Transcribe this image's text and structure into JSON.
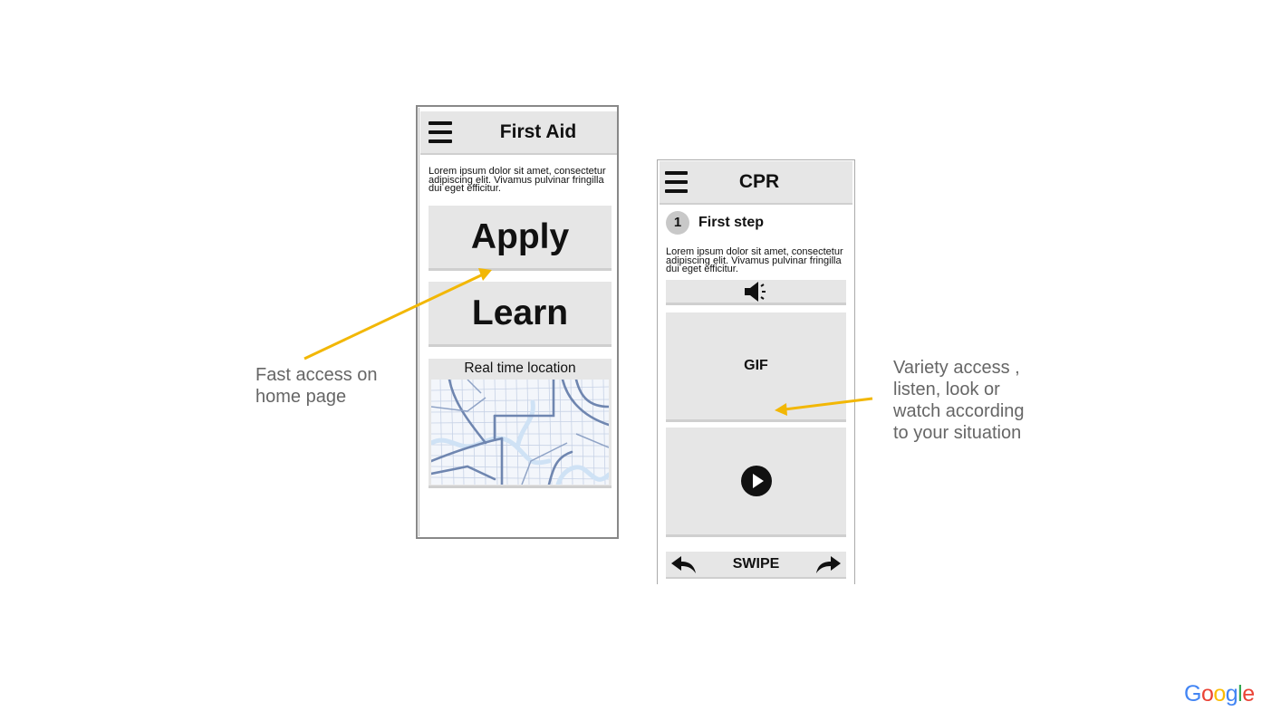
{
  "phone_home": {
    "title": "First Aid",
    "description": "Lorem ipsum dolor sit amet, consectetur adipiscing elit. Vivamus pulvinar fringilla dui eget efficitur.",
    "apply_label": "Apply",
    "learn_label": "Learn",
    "map_label": "Real time location"
  },
  "phone_cpr": {
    "title": "CPR",
    "step_number": "1",
    "step_title": "First step",
    "description": "Lorem ipsum dolor sit amet, consectetur adipiscing elit. Vivamus pulvinar fringilla dui eget efficitur.",
    "gif_label": "GIF",
    "swipe_label": "SWIPE"
  },
  "annotations": {
    "left_line1": "Fast access on",
    "left_line2": "home page",
    "right_line1": "Variety access ,",
    "right_line2": "listen, look or",
    "right_line3": "watch according",
    "right_line4": "to your situation"
  },
  "colors": {
    "annotation_arrow": "#f2b705",
    "card_bg": "#e6e6e6",
    "annotation_text": "#666666"
  },
  "logo": {
    "letters": [
      "G",
      "o",
      "o",
      "g",
      "l",
      "e"
    ],
    "colors": [
      "#4285F4",
      "#EA4335",
      "#FBBC05",
      "#4285F4",
      "#34A853",
      "#EA4335"
    ]
  }
}
